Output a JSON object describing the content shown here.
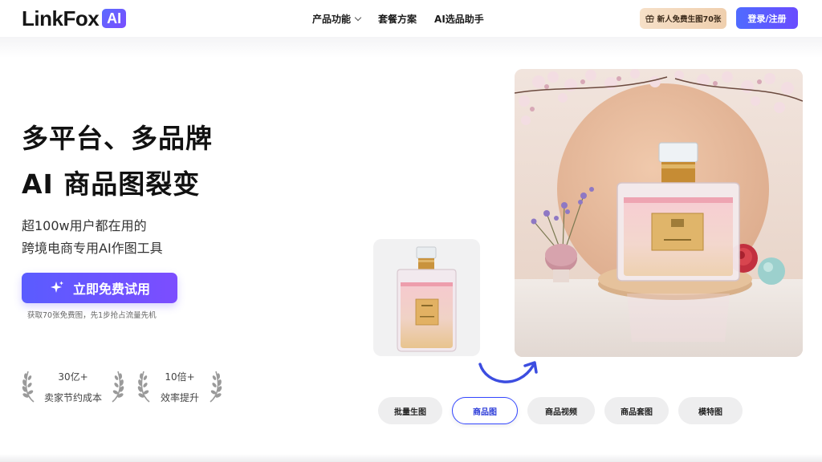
{
  "header": {
    "logo_text": "LinkFox",
    "logo_badge": "AI",
    "nav": [
      {
        "label": "产品功能"
      },
      {
        "label": "套餐方案"
      },
      {
        "label": "AI选品助手"
      }
    ],
    "promo_label": "新人免费生图70张",
    "login_label": "登录/注册"
  },
  "hero": {
    "title_line1": "多平台、多品牌",
    "title_line2": "AI 商品图裂变",
    "subtitle_line1": "超100w用户都在用的",
    "subtitle_line2": "跨境电商专用AI作图工具",
    "cta_label": "立即免费试用",
    "cta_note": "获取70张免费图，先1步抢占流量先机"
  },
  "stats": [
    {
      "value": "30亿+",
      "label": "卖家节约成本"
    },
    {
      "value": "10倍+",
      "label": "效率提升"
    }
  ],
  "tabs": [
    {
      "label": "批量生图",
      "active": false
    },
    {
      "label": "商品图",
      "active": true
    },
    {
      "label": "商品视频",
      "active": false
    },
    {
      "label": "商品套图",
      "active": false
    },
    {
      "label": "模特图",
      "active": false
    }
  ],
  "colors": {
    "accent": "#5a5cff",
    "accent_end": "#7c4dff",
    "active_tab_border": "#3346ff",
    "promo_bg": "#f6e0c8"
  }
}
